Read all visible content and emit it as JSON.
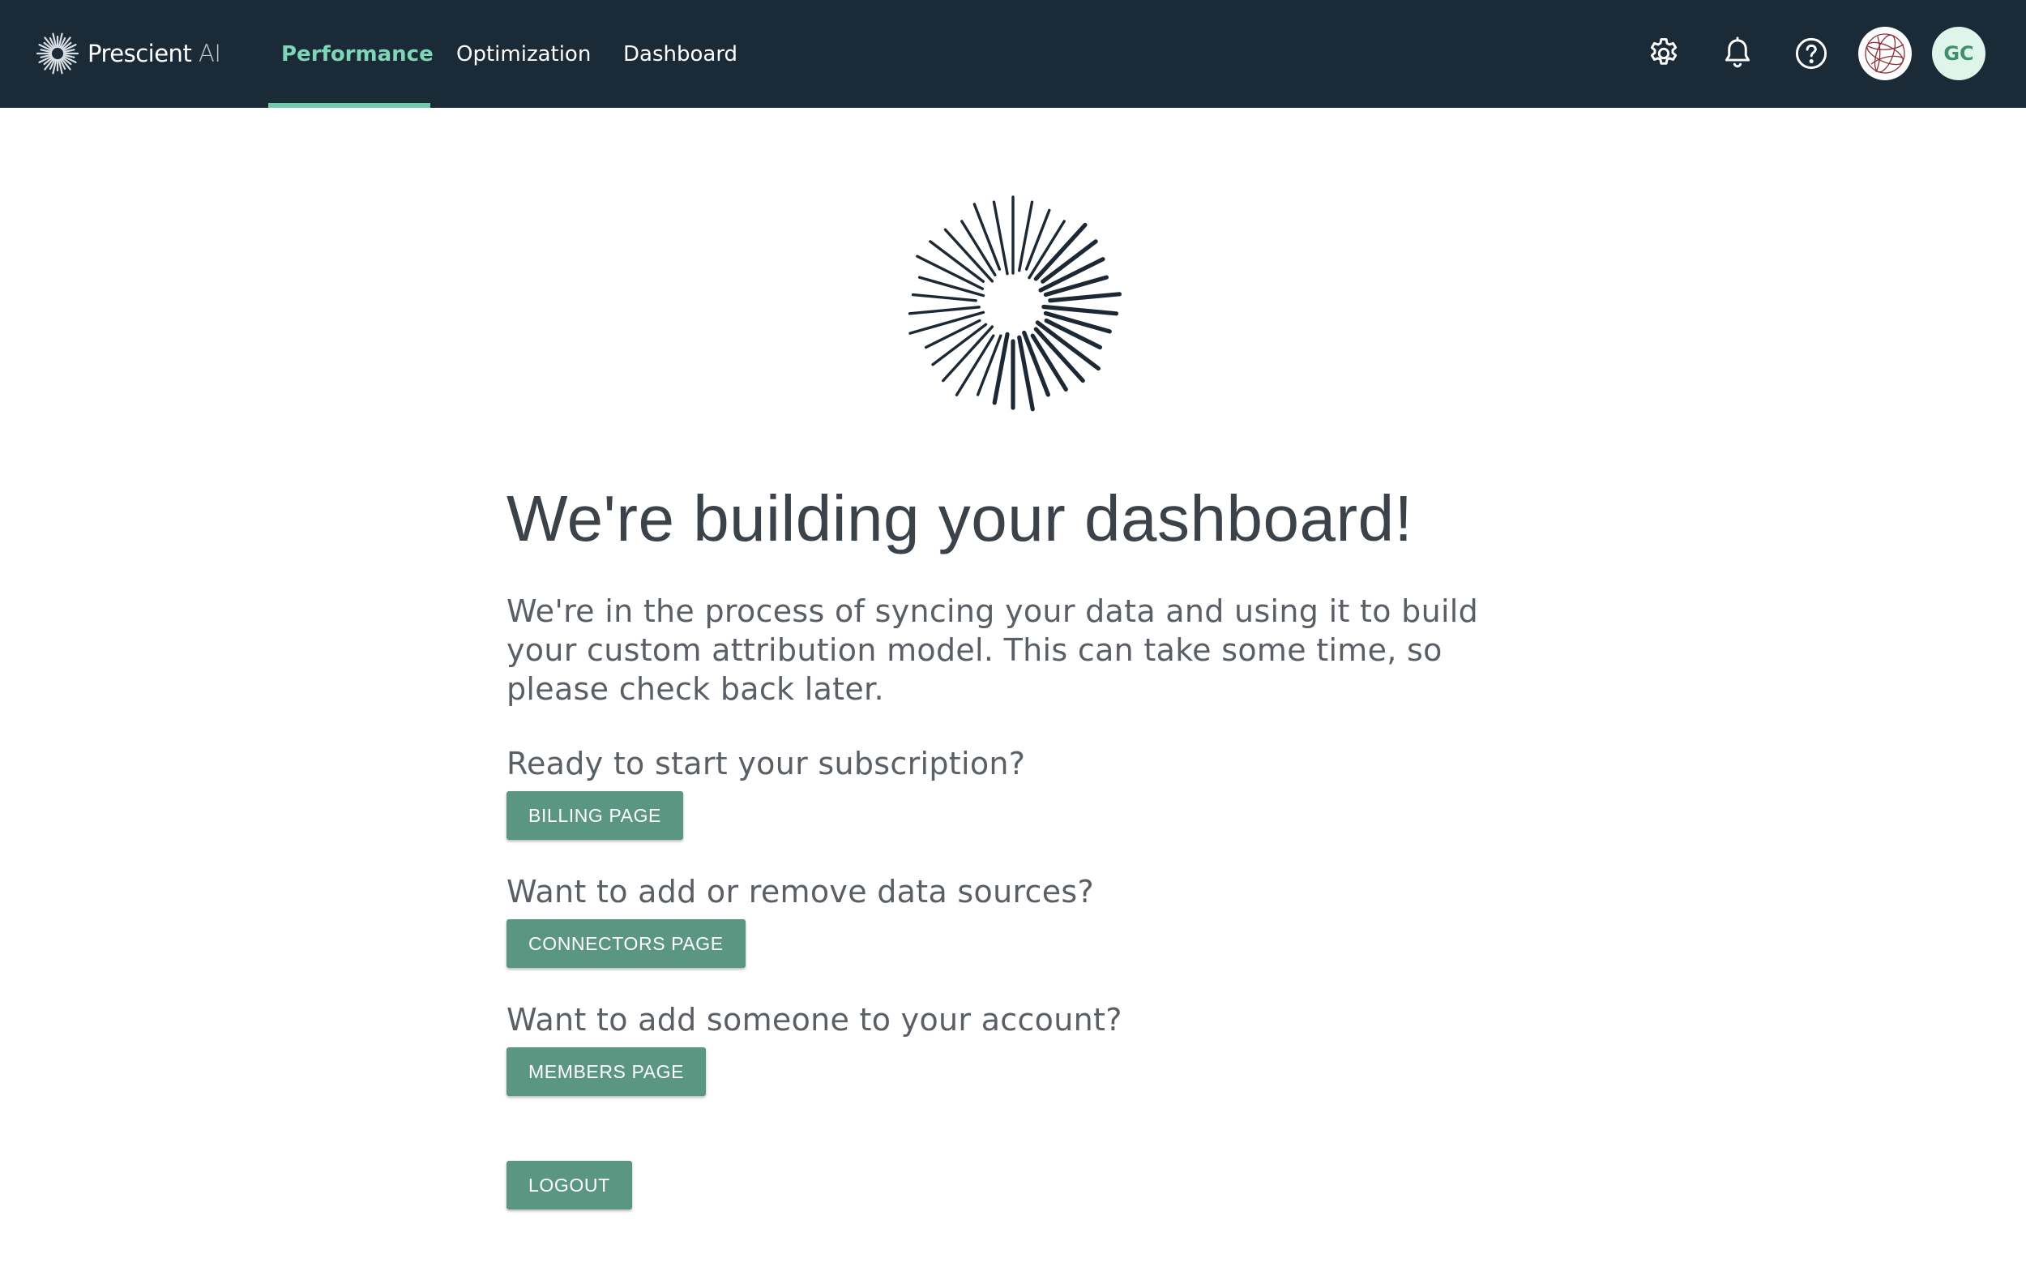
{
  "brand": {
    "name": "Prescient",
    "suffix": "AI"
  },
  "nav": {
    "tabs": [
      {
        "label": "Performance",
        "active": true
      },
      {
        "label": "Optimization",
        "active": false
      },
      {
        "label": "Dashboard",
        "active": false
      }
    ]
  },
  "toolbar": {
    "icons": [
      "gear-icon",
      "bell-icon",
      "help-circle-icon",
      "globe-avatar-icon"
    ],
    "user_initials": "GC"
  },
  "main": {
    "title": "We're building your dashboard!",
    "description": "We're in the process of syncing your data and using it to build your custom attribution model. This can take some time, so please check back later.",
    "sections": [
      {
        "prompt": "Ready to start your subscription?",
        "button_label": "Billing Page"
      },
      {
        "prompt": "Want to add or remove data sources?",
        "button_label": "Connectors Page"
      },
      {
        "prompt": "Want to add someone to your account?",
        "button_label": "Members Page"
      }
    ],
    "logout_label": "Logout"
  },
  "colors": {
    "topbar_background": "#1b2a37",
    "active_tab": "#7fd6b6",
    "tab_underline": "#6fcaa8",
    "button_background": "#5b9683",
    "spinner_stroke": "#1c2833",
    "avatar_background": "#dff5ec",
    "avatar_text": "#3f8f73"
  }
}
